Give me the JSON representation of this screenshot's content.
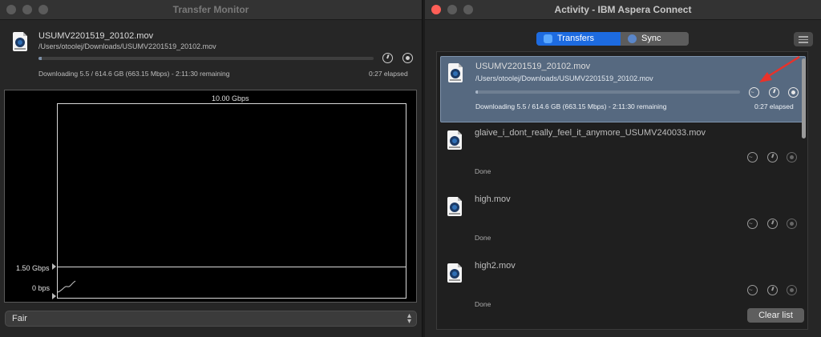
{
  "monitor": {
    "title": "Transfer Monitor",
    "file_name": "USUMV2201519_20102.mov",
    "file_path": "/Users/otoolej/Downloads/USUMV2201519_20102.mov",
    "status": "Downloading 5.5 / 614.6 GB (663.15 Mbps) - 2:11:30 remaining",
    "elapsed": "0:27 elapsed",
    "progress": 0.009,
    "graph": {
      "max_label": "10.00 Gbps",
      "target_label": "1.50 Gbps",
      "min_label": "0 bps"
    },
    "policy": "Fair"
  },
  "activity": {
    "title": "Activity - IBM Aspera Connect",
    "tabs": [
      {
        "label": "Transfers",
        "active": true
      },
      {
        "label": "Sync",
        "active": false
      }
    ],
    "transfers": [
      {
        "name": "USUMV2201519_20102.mov",
        "path": "/Users/otoolej/Downloads/USUMV2201519_20102.mov",
        "status": "Downloading 5.5 / 614.6 GB (663.15 Mbps) - 2:11:30 remaining",
        "elapsed": "0:27 elapsed",
        "progress": 0.009
      },
      {
        "name": "glaive_i_dont_really_feel_it_anymore_USUMV240033.mov",
        "status": "Done"
      },
      {
        "name": "high.mov",
        "status": "Done"
      },
      {
        "name": "high2.mov",
        "status": "Done"
      }
    ],
    "clear_label": "Clear list"
  },
  "colors": {
    "accent": "#1d6be0",
    "selection": "#566980",
    "annotation_arrow": "#e8322a"
  },
  "icons": [
    "file-icon",
    "graph-icon",
    "clock-icon",
    "stop-icon",
    "chevron-updown-icon",
    "menu-icon",
    "arrow-annotation"
  ]
}
